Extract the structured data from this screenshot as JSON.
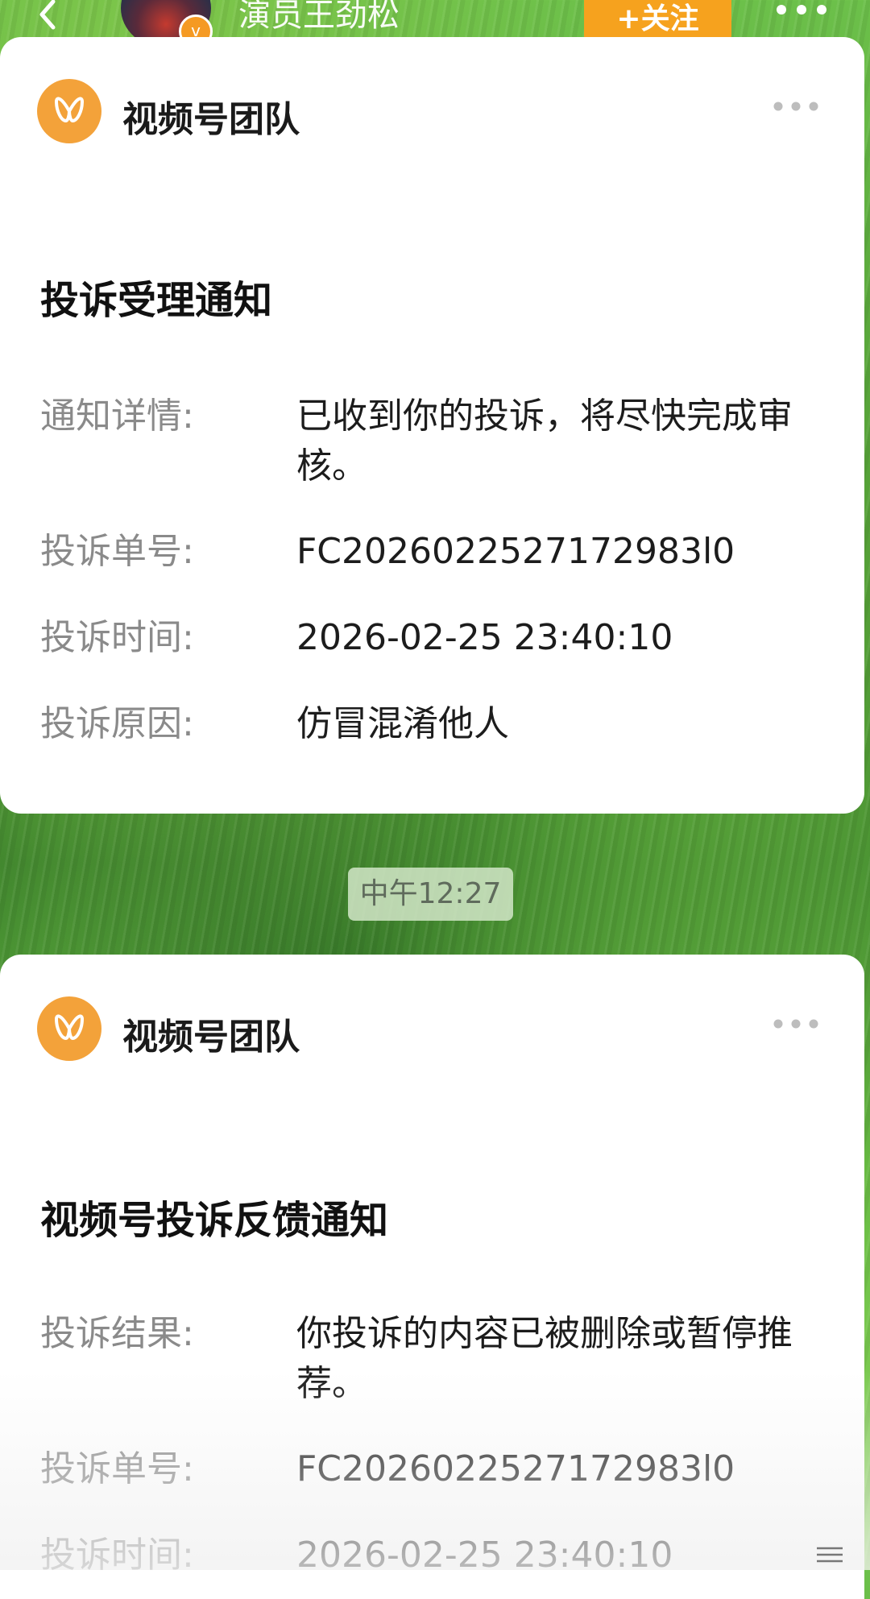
{
  "top_bar": {
    "account_name": "演员王劲松",
    "follow_label": "+关注",
    "verify_badge": "v"
  },
  "messages": [
    {
      "sender": "视频号团队",
      "title": "投诉受理通知",
      "rows": [
        {
          "label": "通知详情:",
          "value": "已收到你的投诉，将尽快完成审核。"
        },
        {
          "label": "投诉单号:",
          "value": "FC2026022527172983l0"
        },
        {
          "label": "投诉时间:",
          "value": "2026-02-25 23:40:10"
        },
        {
          "label": "投诉原因:",
          "value": "仿冒混淆他人"
        }
      ]
    },
    {
      "sender": "视频号团队",
      "title": "视频号投诉反馈通知",
      "rows": [
        {
          "label": "投诉结果:",
          "value": "你投诉的内容已被删除或暂停推荐。"
        },
        {
          "label": "投诉单号:",
          "value": "FC2026022527172983l0"
        },
        {
          "label": "投诉时间:",
          "value": "2026-02-25 23:40:10"
        }
      ]
    }
  ],
  "time_divider": "中午12:27",
  "colors": {
    "accent_orange": "#f6a21e",
    "logo_orange": "#f3a23a",
    "label_gray": "#8a8a8a"
  },
  "icons": {
    "back": "chevron-left-icon",
    "more": "more-dots-icon",
    "logo": "channels-butterfly-icon"
  }
}
